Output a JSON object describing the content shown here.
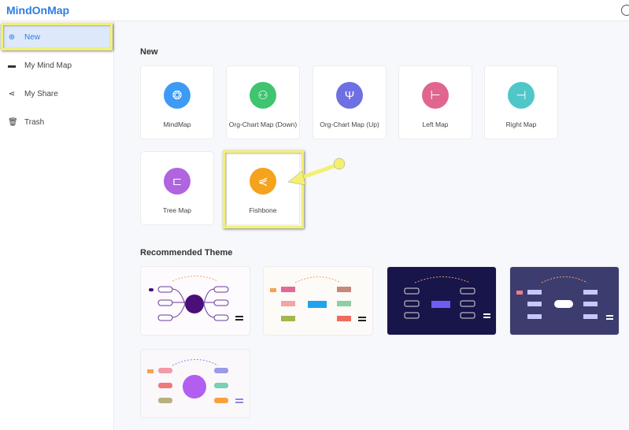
{
  "header": {
    "logo": "MindOnMap",
    "user_icon": "user-circle-icon"
  },
  "sidebar": {
    "items": [
      {
        "label": "New",
        "icon": "plus-circle-icon",
        "active": true
      },
      {
        "label": "My Mind Map",
        "icon": "folder-icon"
      },
      {
        "label": "My Share",
        "icon": "share-icon"
      },
      {
        "label": "Trash",
        "icon": "trash-icon"
      }
    ]
  },
  "main": {
    "new_title": "New",
    "templates": [
      {
        "label": "MindMap",
        "color": "#3d9bf5",
        "icon": "brain-icon"
      },
      {
        "label": "Org-Chart Map (Down)",
        "color": "#3fc46f",
        "icon": "org-down-icon"
      },
      {
        "label": "Org-Chart Map (Up)",
        "color": "#6e6fe2",
        "icon": "org-up-icon"
      },
      {
        "label": "Left Map",
        "color": "#e0668f",
        "icon": "left-map-icon"
      },
      {
        "label": "Right Map",
        "color": "#4fc7c9",
        "icon": "right-map-icon"
      },
      {
        "label": "Tree Map",
        "color": "#b064e0",
        "icon": "tree-map-icon"
      },
      {
        "label": "Fishbone",
        "color": "#f5a31c",
        "icon": "fishbone-icon"
      }
    ],
    "theme_title": "Recommended Theme",
    "themes": [
      {
        "bg": "#fdfbfd"
      },
      {
        "bg": "#fdfbf8"
      },
      {
        "bg": "#17154a"
      },
      {
        "bg": "#3c3d6e"
      },
      {
        "bg": "#fbf8fb"
      }
    ]
  },
  "annotation": {
    "highlight_color": "#f3f071"
  }
}
